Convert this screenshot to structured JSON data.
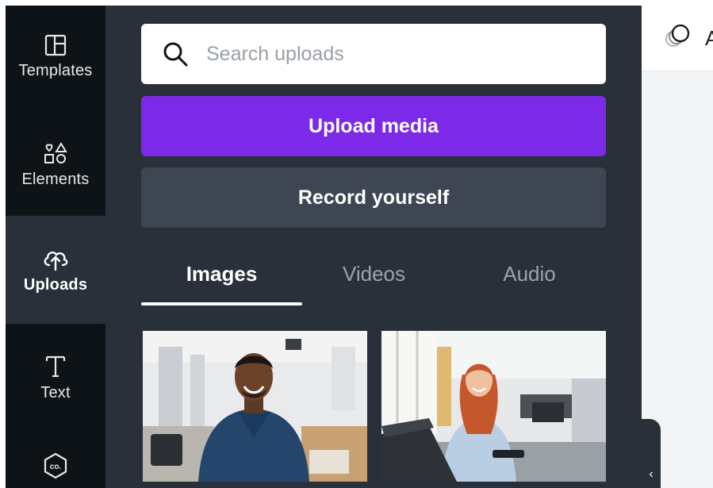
{
  "sidebar": {
    "items": [
      {
        "label": "Templates",
        "icon": "templates-icon"
      },
      {
        "label": "Elements",
        "icon": "elements-icon"
      },
      {
        "label": "Uploads",
        "icon": "uploads-icon",
        "active": true
      },
      {
        "label": "Text",
        "icon": "text-icon"
      },
      {
        "label": "",
        "icon": "brand-icon"
      }
    ]
  },
  "search": {
    "placeholder": "Search uploads"
  },
  "buttons": {
    "upload": "Upload media",
    "record": "Record yourself"
  },
  "tabs": [
    {
      "label": "Images",
      "active": true
    },
    {
      "label": "Videos"
    },
    {
      "label": "Audio"
    }
  ],
  "header": {
    "partial_text": "A"
  },
  "collapse": {
    "glyph": "‹"
  },
  "colors": {
    "rail_bg": "#0e1318",
    "panel_bg": "#293039",
    "accent": "#7d2ae8",
    "secondary_button": "#3d4652",
    "active_text": "#ffffff",
    "inactive_tab": "#9aa3ad"
  }
}
